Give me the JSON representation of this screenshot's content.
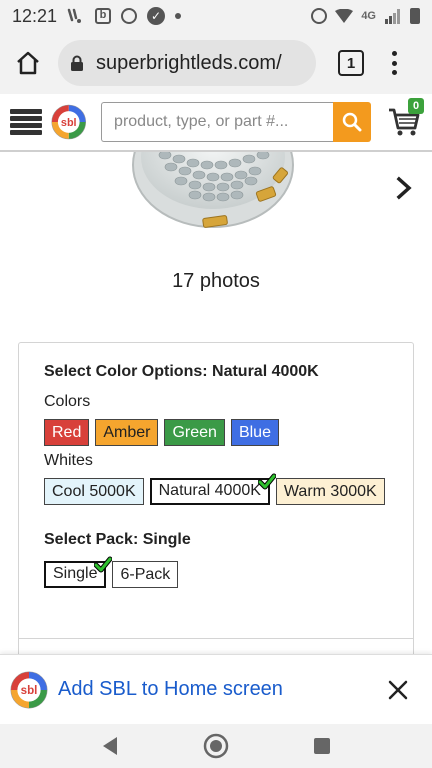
{
  "status_bar": {
    "time": "12:21",
    "network": "4G",
    "icons": [
      "notification-icon",
      "b-app-icon",
      "alarm-icon",
      "check-circle-icon",
      "dot-icon",
      "alarm-icon",
      "wifi-icon",
      "signal-icon",
      "battery-icon"
    ]
  },
  "browser": {
    "url": "superbrightleds.com/",
    "tab_count": "1"
  },
  "site_header": {
    "logo_text": "sbl",
    "search_placeholder": "product, type, or part #...",
    "cart_count": "0",
    "accent_color": "#f39a1e"
  },
  "gallery": {
    "photo_count": "17 photos"
  },
  "options": {
    "color_title": "Select Color Options: Natural 4000K",
    "colors_label": "Colors",
    "colors": [
      {
        "label": "Red",
        "color": "#d8403a"
      },
      {
        "label": "Amber",
        "color": "#f5a52e"
      },
      {
        "label": "Green",
        "color": "#3b9a47"
      },
      {
        "label": "Blue",
        "color": "#3f6ee3"
      }
    ],
    "whites_label": "Whites",
    "whites": [
      {
        "label": "Cool 5000K",
        "selected": false
      },
      {
        "label": "Natural 4000K",
        "selected": true
      },
      {
        "label": "Warm 3000K",
        "selected": false
      }
    ],
    "pack_title": "Select Pack: Single",
    "packs": [
      {
        "label": "Single",
        "selected": true
      },
      {
        "label": "6-Pack",
        "selected": false
      }
    ]
  },
  "a2hs": {
    "label": "Add SBL to Home screen"
  }
}
